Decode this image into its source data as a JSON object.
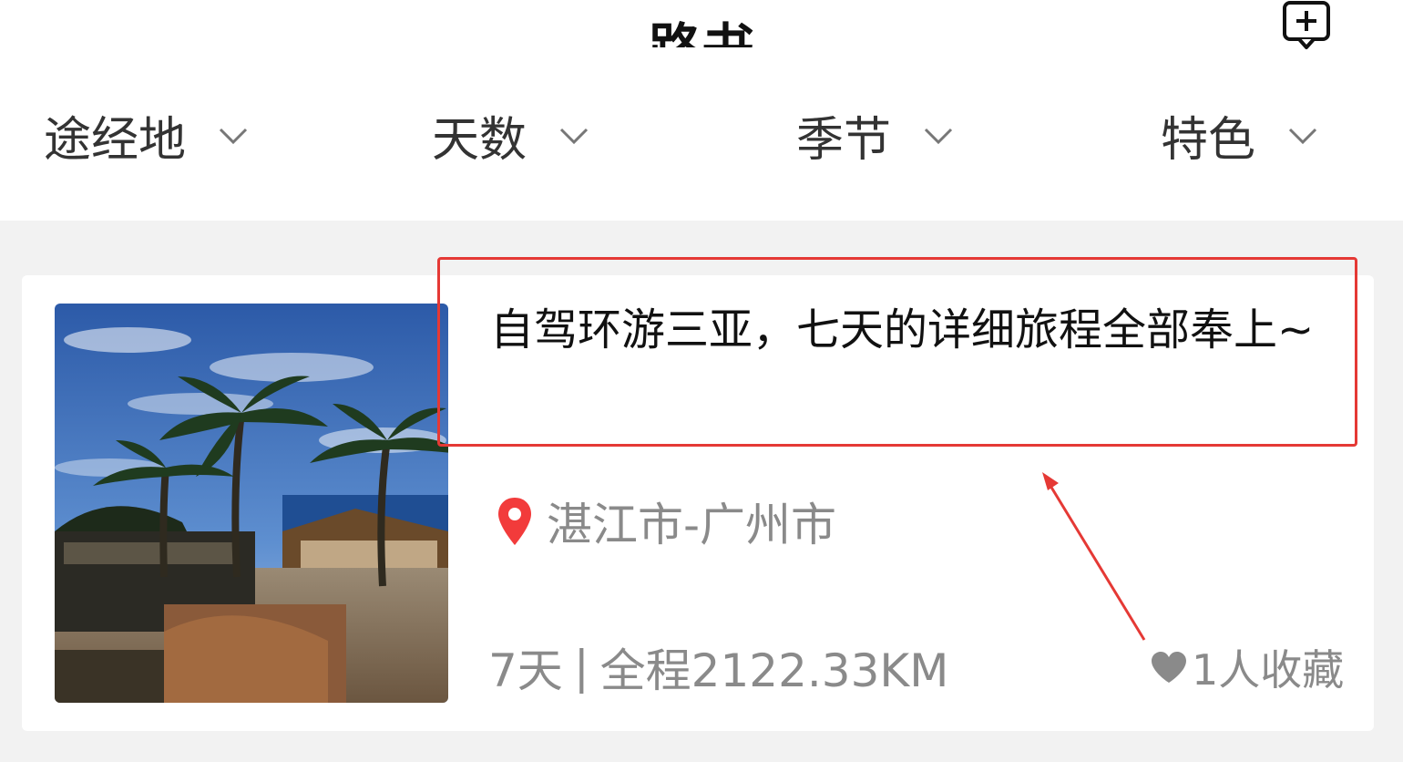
{
  "header": {
    "title": "路书",
    "add_icon": "add-comment-icon"
  },
  "filters": [
    {
      "label": "途经地",
      "icon": "chevron-down-icon"
    },
    {
      "label": "天数",
      "icon": "chevron-down-icon"
    },
    {
      "label": "季节",
      "icon": "chevron-down-icon"
    },
    {
      "label": "特色",
      "icon": "chevron-down-icon"
    }
  ],
  "route_card": {
    "title": "自驾环游三亚，七天的详细旅程全部奉上~",
    "location": "湛江市-广州市",
    "location_icon": "location-pin-icon",
    "days": "7天",
    "separator": "|",
    "distance": "全程2122.33KM",
    "favorites_icon": "heart-icon",
    "favorites": "1人收藏",
    "thumbnail": "palm-trees-resort-photo"
  },
  "annotation": {
    "highlight_color": "#e53935"
  },
  "colors": {
    "background": "#f2f2f2",
    "card": "#ffffff",
    "pin": "#f23b3b",
    "muted_text": "#8a8a8a"
  }
}
